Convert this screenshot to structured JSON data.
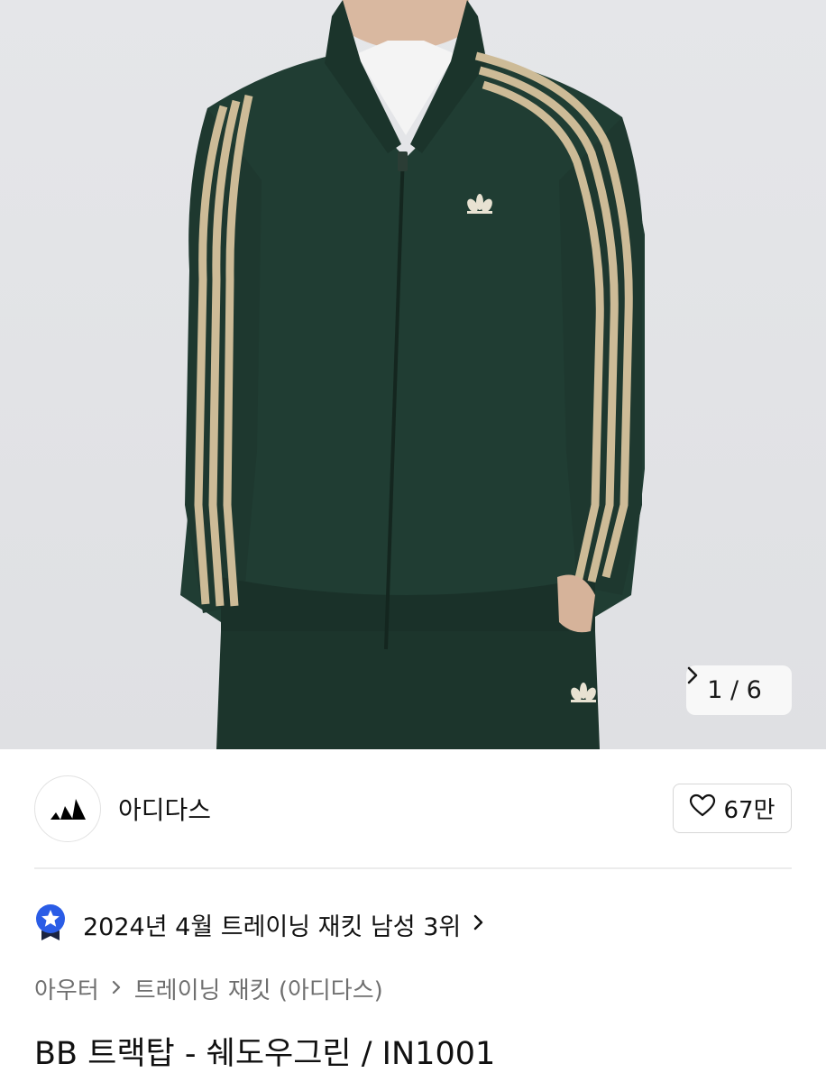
{
  "gallery": {
    "counter": "1 / 6",
    "next_icon": "chevron-right-icon"
  },
  "brand": {
    "name": "아디다스",
    "logo_icon": "adidas-logo-icon",
    "like_icon": "heart-outline-icon",
    "like_count": "67만"
  },
  "ranking": {
    "badge_icon": "star-award-badge-icon",
    "text": "2024년 4월 트레이닝 재킷 남성 3위",
    "chevron_icon": "chevron-right-icon"
  },
  "breadcrumb": {
    "items": [
      "아우터",
      "트레이닝 재킷 (아디다스)"
    ],
    "separator_icon": "chevron-right-icon"
  },
  "product": {
    "title": "BB 트랙탑 - 쉐도우그린 / IN1001"
  },
  "colors": {
    "jacket_green": "#203d33",
    "stripe_beige": "#cdbb97",
    "badge_blue": "#2a5ce6"
  }
}
